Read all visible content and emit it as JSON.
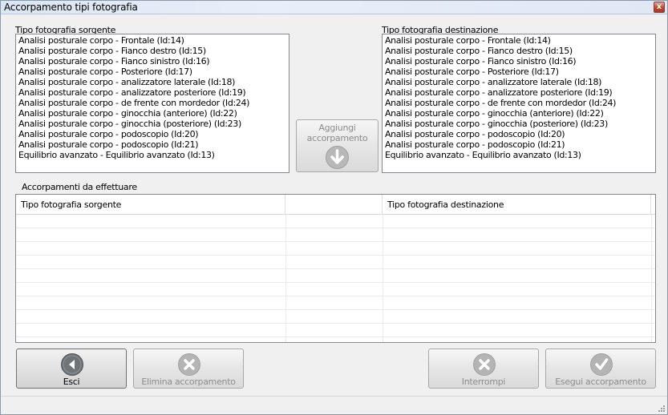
{
  "window": {
    "title": "Accorpamento tipi fotografia",
    "close_glyph": "x"
  },
  "source": {
    "label": "Tipo fotografia sorgente",
    "items": [
      "Analisi posturale corpo - Frontale (Id:14)",
      "Analisi posturale corpo - Fianco destro (Id:15)",
      "Analisi posturale corpo - Fianco sinistro (Id:16)",
      "Analisi posturale corpo - Posteriore (Id:17)",
      "Analisi posturale corpo - analizzatore laterale (Id:18)",
      "Analisi posturale corpo - analizzatore posteriore (Id:19)",
      "Analisi posturale corpo - de frente con mordedor (Id:24)",
      "Analisi posturale corpo - ginocchia (anteriore) (Id:22)",
      "Analisi posturale corpo - ginocchia (posteriore) (Id:23)",
      "Analisi posturale corpo - podoscopio (Id:20)",
      "Analisi posturale corpo - podoscopio (Id:21)",
      "Equilibrio avanzato - Equilibrio avanzato (Id:13)"
    ]
  },
  "destination": {
    "label": "Tipo fotografia destinazione",
    "items": [
      "Analisi posturale corpo - Frontale (Id:14)",
      "Analisi posturale corpo - Fianco destro (Id:15)",
      "Analisi posturale corpo - Fianco sinistro (Id:16)",
      "Analisi posturale corpo - Posteriore (Id:17)",
      "Analisi posturale corpo - analizzatore laterale (Id:18)",
      "Analisi posturale corpo - analizzatore posteriore (Id:19)",
      "Analisi posturale corpo - de frente con mordedor (Id:24)",
      "Analisi posturale corpo - ginocchia (anteriore) (Id:22)",
      "Analisi posturale corpo - ginocchia (posteriore) (Id:23)",
      "Analisi posturale corpo - podoscopio (Id:20)",
      "Analisi posturale corpo - podoscopio (Id:21)",
      "Equilibrio avanzato - Equilibrio avanzato (Id:13)"
    ]
  },
  "add_button": {
    "label_line1": "Aggiungi",
    "label_line2": "accorpamento",
    "icon": "arrow-down-circle-icon"
  },
  "grid": {
    "label": "Accorpamenti da effettuare",
    "columns": [
      "Tipo fotografia sorgente",
      "",
      "Tipo fotografia destinazione"
    ],
    "rows": []
  },
  "buttons": {
    "exit": "Esci",
    "delete": "Elimina accorpamento",
    "stop": "Interrompi",
    "execute": "Esegui accorpamento"
  },
  "colors": {
    "disabled_icon": "#b4b4b4",
    "exit_icon": "#6f7479"
  }
}
